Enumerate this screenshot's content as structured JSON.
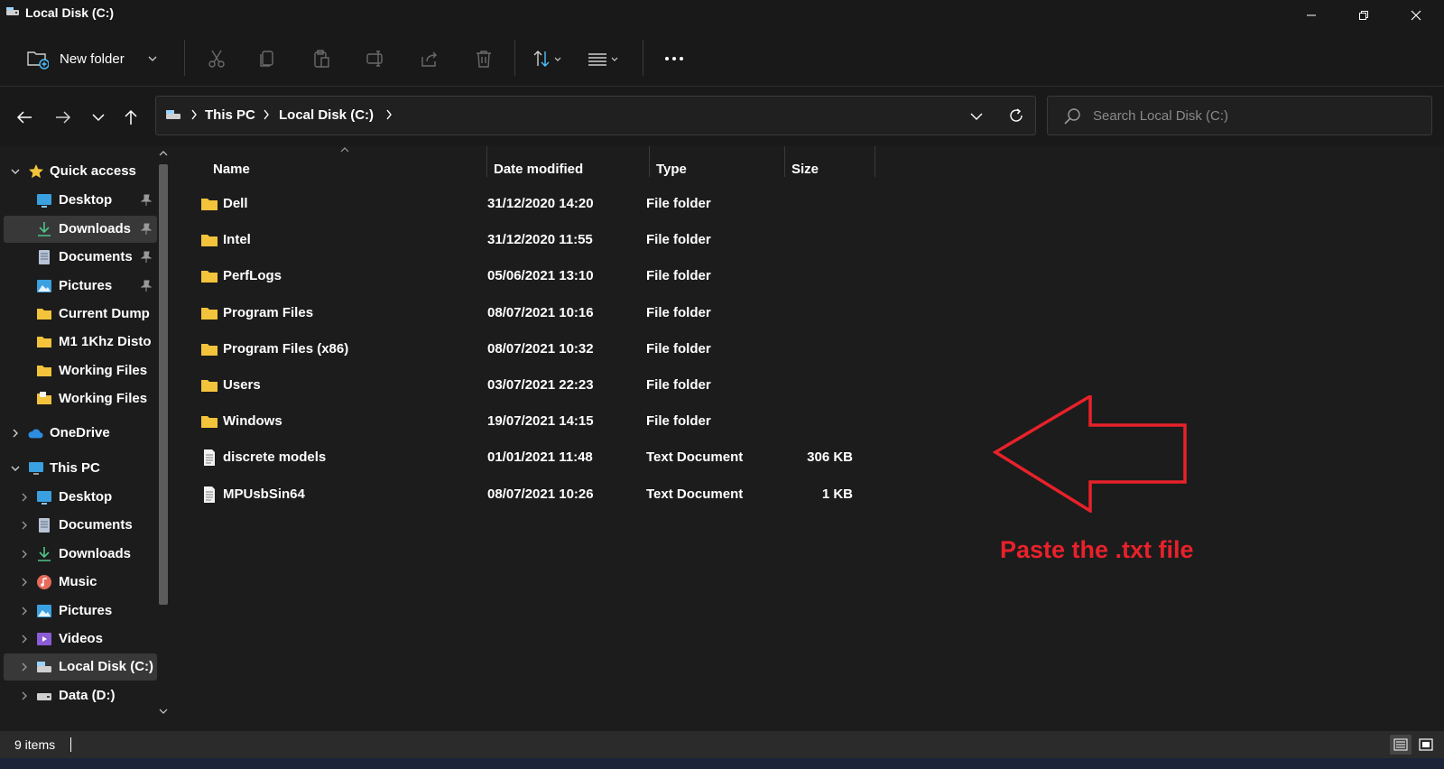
{
  "window": {
    "title": "Local Disk (C:)"
  },
  "commandbar": {
    "new_folder_label": "New folder",
    "icons": [
      "cut-icon",
      "copy-icon",
      "paste-icon",
      "rename-icon",
      "share-icon",
      "delete-icon",
      "sort-icon",
      "view-icon",
      "more-icon"
    ]
  },
  "address": {
    "crumbs": [
      "This PC",
      "Local Disk (C:)"
    ]
  },
  "search": {
    "placeholder": "Search Local Disk (C:)"
  },
  "sidebar": {
    "quick_access": {
      "label": "Quick access",
      "items": [
        {
          "label": "Desktop",
          "icon": "desktop-icon",
          "pinned": true
        },
        {
          "label": "Downloads",
          "icon": "download-icon",
          "pinned": true,
          "selected": true
        },
        {
          "label": "Documents",
          "icon": "document-icon",
          "pinned": true
        },
        {
          "label": "Pictures",
          "icon": "pictures-icon",
          "pinned": true
        },
        {
          "label": "Current Dump",
          "icon": "folder-icon"
        },
        {
          "label": "M1 1Khz Disto",
          "icon": "folder-icon"
        },
        {
          "label": "Working Files",
          "icon": "folder-icon"
        },
        {
          "label": "Working Files",
          "icon": "folder-icon"
        }
      ]
    },
    "onedrive": {
      "label": "OneDrive"
    },
    "this_pc": {
      "label": "This PC",
      "items": [
        {
          "label": "Desktop",
          "icon": "desktop-icon"
        },
        {
          "label": "Documents",
          "icon": "document-icon"
        },
        {
          "label": "Downloads",
          "icon": "download-icon"
        },
        {
          "label": "Music",
          "icon": "music-icon"
        },
        {
          "label": "Pictures",
          "icon": "pictures-icon"
        },
        {
          "label": "Videos",
          "icon": "videos-icon"
        },
        {
          "label": "Local Disk (C:)",
          "icon": "drive-icon",
          "selected": true
        },
        {
          "label": "Data (D:)",
          "icon": "drive-icon"
        }
      ]
    }
  },
  "columns": {
    "name": "Name",
    "date": "Date modified",
    "type": "Type",
    "size": "Size"
  },
  "files": [
    {
      "name": "Dell",
      "date": "31/12/2020 14:20",
      "type": "File folder",
      "size": "",
      "icon": "folder-icon"
    },
    {
      "name": "Intel",
      "date": "31/12/2020 11:55",
      "type": "File folder",
      "size": "",
      "icon": "folder-icon"
    },
    {
      "name": "PerfLogs",
      "date": "05/06/2021 13:10",
      "type": "File folder",
      "size": "",
      "icon": "folder-icon"
    },
    {
      "name": "Program Files",
      "date": "08/07/2021 10:16",
      "type": "File folder",
      "size": "",
      "icon": "folder-icon"
    },
    {
      "name": "Program Files (x86)",
      "date": "08/07/2021 10:32",
      "type": "File folder",
      "size": "",
      "icon": "folder-icon"
    },
    {
      "name": "Users",
      "date": "03/07/2021 22:23",
      "type": "File folder",
      "size": "",
      "icon": "folder-icon"
    },
    {
      "name": "Windows",
      "date": "19/07/2021 14:15",
      "type": "File folder",
      "size": "",
      "icon": "folder-icon"
    },
    {
      "name": "discrete models",
      "date": "01/01/2021 11:48",
      "type": "Text Document",
      "size": "306 KB",
      "icon": "text-file-icon"
    },
    {
      "name": "MPUsbSin64",
      "date": "08/07/2021 10:26",
      "type": "Text Document",
      "size": "1 KB",
      "icon": "text-file-icon"
    }
  ],
  "annotation": {
    "text": "Paste the .txt file",
    "color": "#e8212a"
  },
  "status": {
    "item_count": "9 items"
  },
  "colors": {
    "background": "#1c1c1c",
    "folder": "#f3c33b",
    "accent": "#4cc2ff"
  }
}
